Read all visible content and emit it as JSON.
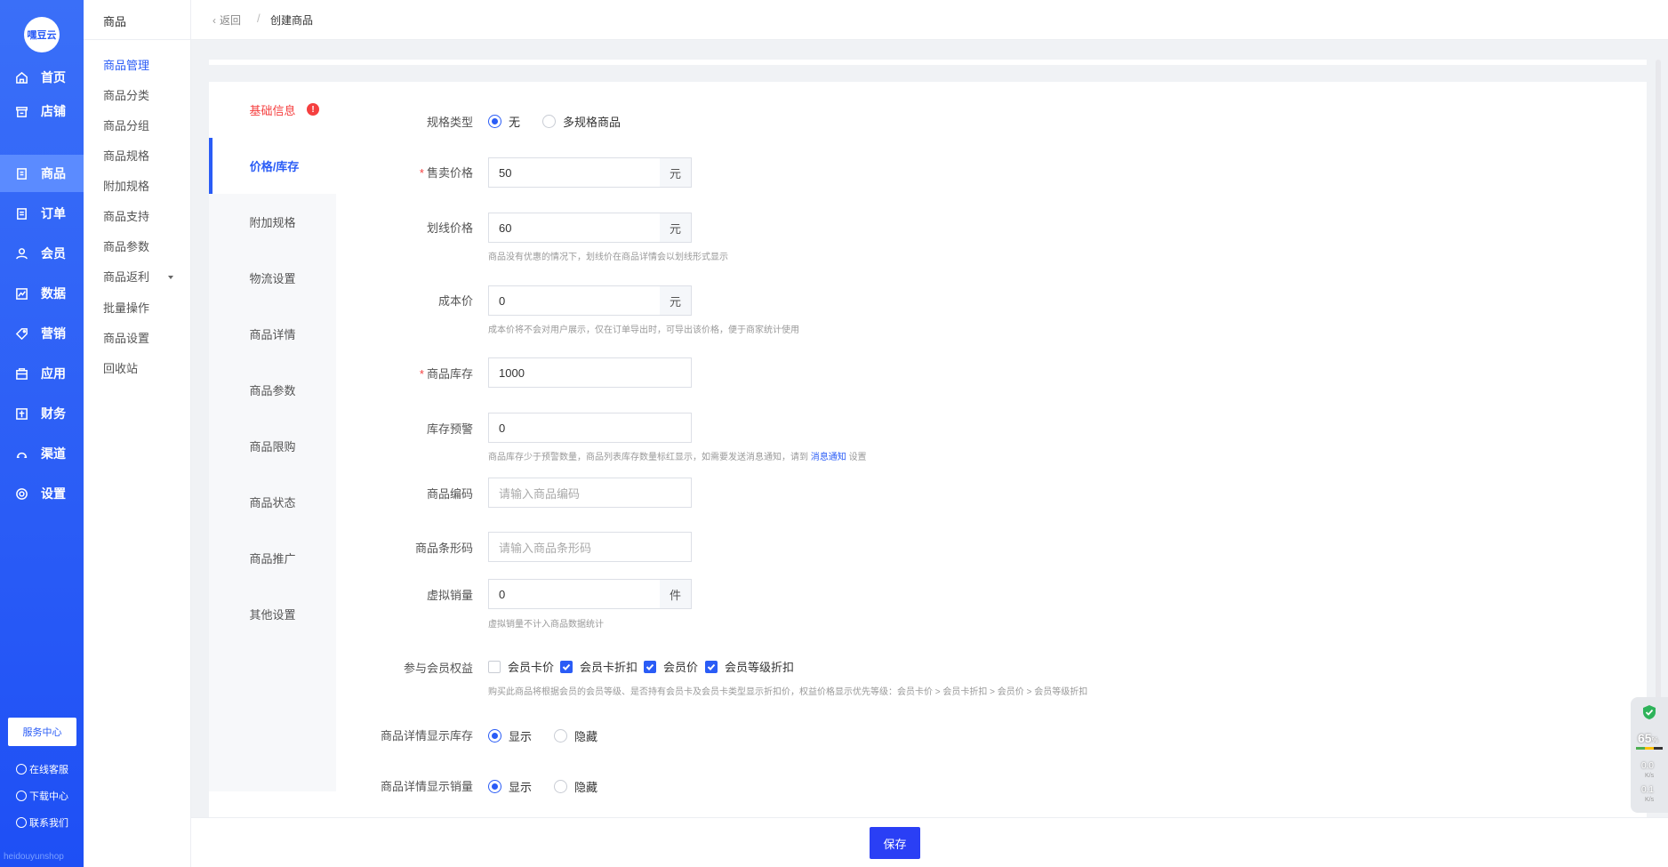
{
  "brand": {
    "logo_text": "嘿豆云",
    "footer_text": "heidouyunshop"
  },
  "nav": {
    "items": [
      {
        "label": "首页",
        "icon": "home-icon"
      },
      {
        "label": "店铺",
        "icon": "store-icon"
      },
      {
        "label": "商品",
        "icon": "goods-icon",
        "active": true
      },
      {
        "label": "订单",
        "icon": "order-icon"
      },
      {
        "label": "会员",
        "icon": "member-icon"
      },
      {
        "label": "数据",
        "icon": "data-icon"
      },
      {
        "label": "营销",
        "icon": "tag-icon"
      },
      {
        "label": "应用",
        "icon": "app-icon"
      },
      {
        "label": "财务",
        "icon": "finance-icon"
      },
      {
        "label": "渠道",
        "icon": "channel-icon"
      },
      {
        "label": "设置",
        "icon": "settings-icon"
      }
    ],
    "service_center": "服务中心",
    "online_service": "在线客服",
    "download_center": "下载中心",
    "contact_us": "联系我们"
  },
  "subnav": {
    "title": "商品",
    "items": [
      "商品管理",
      "商品分类",
      "商品分组",
      "商品规格",
      "附加规格",
      "商品支持",
      "商品参数",
      "商品返利",
      "批量操作",
      "商品设置",
      "回收站"
    ]
  },
  "topbar": {
    "back": "返回",
    "separator": "/",
    "current": "创建商品"
  },
  "tabs": [
    "基础信息",
    "价格/库存",
    "附加规格",
    "物流设置",
    "商品详情",
    "商品参数",
    "商品限购",
    "商品状态",
    "商品推广",
    "其他设置"
  ],
  "form": {
    "spec_type": {
      "label": "规格类型",
      "options": [
        "无",
        "多规格商品"
      ]
    },
    "sale_price": {
      "label": "售卖价格",
      "value": "50",
      "unit": "元"
    },
    "line_price": {
      "label": "划线价格",
      "value": "60",
      "unit": "元",
      "hint": "商品没有优惠的情况下，划线价在商品详情会以划线形式显示"
    },
    "cost_price": {
      "label": "成本价",
      "value": "0",
      "unit": "元",
      "hint": "成本价将不会对用户展示，仅在订单导出时，可导出该价格，便于商家统计使用"
    },
    "stock": {
      "label": "商品库存",
      "value": "1000"
    },
    "stock_warn": {
      "label": "库存预警",
      "value": "0",
      "hint_pre": "商品库存少于预警数量，商品列表库存数量标红显示，如需要发送消息通知，请到",
      "hint_link": "消息通知",
      "hint_post": "设置"
    },
    "code": {
      "label": "商品编码",
      "placeholder": "请输入商品编码"
    },
    "barcode": {
      "label": "商品条形码",
      "placeholder": "请输入商品条形码"
    },
    "virtual_sales": {
      "label": "虚拟销量",
      "value": "0",
      "unit": "件",
      "hint": "虚拟销量不计入商品数据统计"
    },
    "member_rights": {
      "label": "参与会员权益",
      "options": [
        "会员卡价",
        "会员卡折扣",
        "会员价",
        "会员等级折扣"
      ],
      "hint": "购买此商品将根据会员的会员等级、是否持有会员卡及会员卡类型显示折扣价，权益价格显示优先等级：会员卡价 > 会员卡折扣 > 会员价 > 会员等级折扣"
    },
    "show_stock": {
      "label": "商品详情显示库存",
      "options": [
        "显示",
        "隐藏"
      ]
    },
    "show_sales": {
      "label": "商品详情显示销量",
      "options": [
        "显示",
        "隐藏"
      ]
    }
  },
  "footer": {
    "save": "保存"
  },
  "widget": {
    "percent": "65",
    "percent_unit": "%",
    "up": "0.0",
    "down": "0.1",
    "unit": "K/s"
  },
  "colors": {
    "primary": "#2a5cf6",
    "error": "#f53f3f",
    "button": "#2a3ff5"
  }
}
